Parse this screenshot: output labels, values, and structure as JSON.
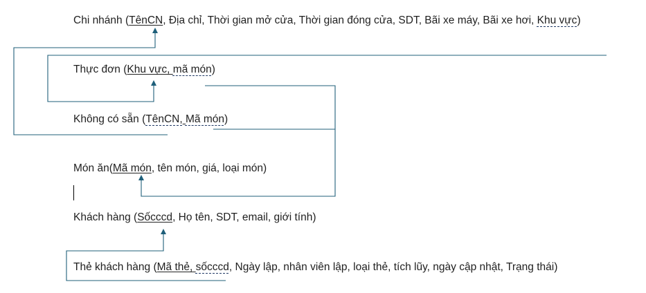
{
  "relations": {
    "chi_nhanh": {
      "name": "Chi nhánh",
      "open": " (",
      "key1": "TênCN",
      "rest": ", Địa chỉ, Thời gian mở cửa, Thời gian đóng cửa, SDT, Bãi xe máy, Bãi xe hơi, ",
      "fk1": "Khu vực",
      "close": ")"
    },
    "thuc_don": {
      "name": "Thực đơn",
      "open": " (",
      "key1": "Khu vực,",
      "sep": " ",
      "key2": "mã món",
      "close": ")"
    },
    "khong_co_san": {
      "name": "Không có sẵn",
      "open": " (",
      "key1": "TênCN,",
      "sep": " ",
      "key2": "Mã món",
      "close": ")"
    },
    "mon_an": {
      "name": "Món ăn",
      "open": "(",
      "key1": "Mã món",
      "rest": ", tên món, giá, loại món)"
    },
    "khach_hang": {
      "name": "Khách hàng",
      "open": " (",
      "key1": "Sốcccd",
      "rest": ", Họ tên, SDT, email, giới tính)"
    },
    "the_khach_hang": {
      "name": "Thẻ khách hàng",
      "open": " (",
      "key1": "Mã thẻ,",
      "sep": " ",
      "key2": "sốcccd",
      "rest": ", Ngày lập, nhân viên lập, loại thẻ, tích lũy, ngày cập nhật, Trạng thái)"
    }
  },
  "colors": {
    "connector": "#1f5f7a",
    "text": "#1f1f1f"
  }
}
